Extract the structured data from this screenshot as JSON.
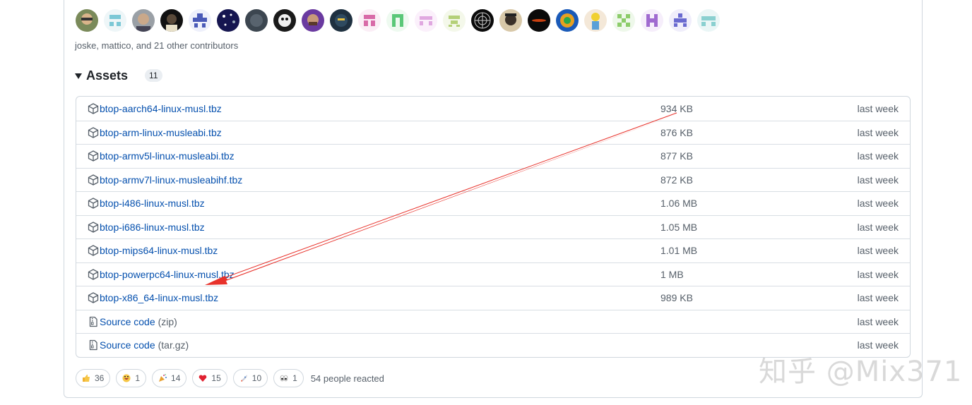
{
  "contributors": {
    "avatar_count": 23,
    "summary": "joske, mattico, and 21 other contributors"
  },
  "assets": {
    "title": "Assets",
    "count": "11",
    "rows": [
      {
        "name": "btop-aarch64-linux-musl.tbz",
        "ext": "",
        "size": "934 KB",
        "time": "last week",
        "icon": "package-icon"
      },
      {
        "name": "btop-arm-linux-musleabi.tbz",
        "ext": "",
        "size": "876 KB",
        "time": "last week",
        "icon": "package-icon"
      },
      {
        "name": "btop-armv5l-linux-musleabi.tbz",
        "ext": "",
        "size": "877 KB",
        "time": "last week",
        "icon": "package-icon"
      },
      {
        "name": "btop-armv7l-linux-musleabihf.tbz",
        "ext": "",
        "size": "872 KB",
        "time": "last week",
        "icon": "package-icon"
      },
      {
        "name": "btop-i486-linux-musl.tbz",
        "ext": "",
        "size": "1.06 MB",
        "time": "last week",
        "icon": "package-icon"
      },
      {
        "name": "btop-i686-linux-musl.tbz",
        "ext": "",
        "size": "1.05 MB",
        "time": "last week",
        "icon": "package-icon"
      },
      {
        "name": "btop-mips64-linux-musl.tbz",
        "ext": "",
        "size": "1.01 MB",
        "time": "last week",
        "icon": "package-icon"
      },
      {
        "name": "btop-powerpc64-linux-musl.tbz",
        "ext": "",
        "size": "1 MB",
        "time": "last week",
        "icon": "package-icon"
      },
      {
        "name": "btop-x86_64-linux-musl.tbz",
        "ext": "",
        "size": "989 KB",
        "time": "last week",
        "icon": "package-icon"
      },
      {
        "name": "Source code",
        "ext": "(zip)",
        "size": "",
        "time": "last week",
        "icon": "file-zip-icon"
      },
      {
        "name": "Source code",
        "ext": "(tar.gz)",
        "size": "",
        "time": "last week",
        "icon": "file-zip-icon"
      }
    ]
  },
  "reactions": {
    "items": [
      {
        "emoji": "thumbs-up",
        "count": "36"
      },
      {
        "emoji": "laugh",
        "count": "1"
      },
      {
        "emoji": "hooray",
        "count": "14"
      },
      {
        "emoji": "heart",
        "count": "15"
      },
      {
        "emoji": "rocket",
        "count": "10"
      },
      {
        "emoji": "eyes",
        "count": "1"
      }
    ],
    "summary": "54 people reacted"
  },
  "watermark": "知乎 @Mix371",
  "colors": {
    "link": "#0969da",
    "muted": "#57606a",
    "border": "#d0d7de",
    "arrow": "#e8322b"
  }
}
